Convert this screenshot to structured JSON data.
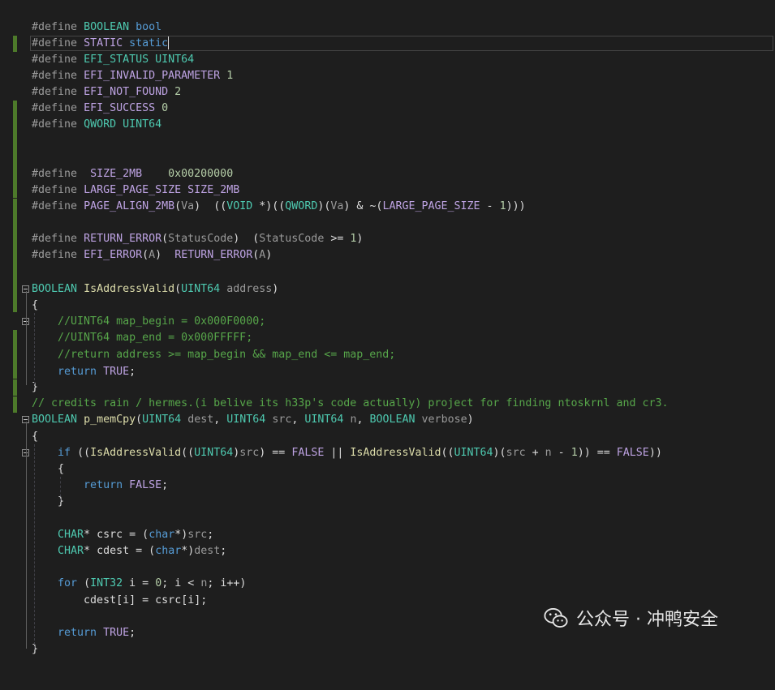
{
  "lines": [
    "",
    "#define BOOLEAN bool",
    "#define STATIC static",
    "#define EFI_STATUS UINT64",
    "#define EFI_INVALID_PARAMETER 1",
    "#define EFI_NOT_FOUND 2",
    "#define EFI_SUCCESS 0",
    "#define QWORD UINT64",
    "",
    "",
    "#define  SIZE_2MB    0x00200000",
    "#define LARGE_PAGE_SIZE SIZE_2MB",
    "#define PAGE_ALIGN_2MB(Va)  ((VOID *)((QWORD)(Va) & ~(LARGE_PAGE_SIZE - 1)))",
    "",
    "#define RETURN_ERROR(StatusCode)  (StatusCode >= 1)",
    "#define EFI_ERROR(A)  RETURN_ERROR(A)",
    "",
    "BOOLEAN IsAddressValid(UINT64 address)",
    "{",
    "    //UINT64 map_begin = 0x000F0000;",
    "    //UINT64 map_end = 0x000FFFFF;",
    "    //return address >= map_begin && map_end <= map_end;",
    "    return TRUE;",
    "}",
    "// credits rain / hermes.(i belive its h33p's code actually) project for finding ntoskrnl and cr3.",
    "BOOLEAN p_memCpy(UINT64 dest, UINT64 src, UINT64 n, BOOLEAN verbose)",
    "{",
    "    if ((IsAddressValid((UINT64)src) == FALSE || IsAddressValid((UINT64)(src + n - 1)) == FALSE))",
    "    {",
    "        return FALSE;",
    "    }",
    "",
    "    CHAR* csrc = (char*)src;",
    "    CHAR* cdest = (char*)dest;",
    "",
    "    for (INT32 i = 0; i < n; i++)",
    "        cdest[i] = csrc[i];",
    "",
    "    return TRUE;",
    "}"
  ],
  "watermark": {
    "text": "公众号 · 冲鸭安全",
    "icon": "wechat-icon"
  },
  "colors": {
    "background": "#1e1e1e",
    "change_bar": "#4d7a2a",
    "comment": "#57a64a",
    "type": "#4ec9b0",
    "keyword": "#569cd6",
    "macro": "#bea3e3",
    "function": "#dcdcaa"
  }
}
